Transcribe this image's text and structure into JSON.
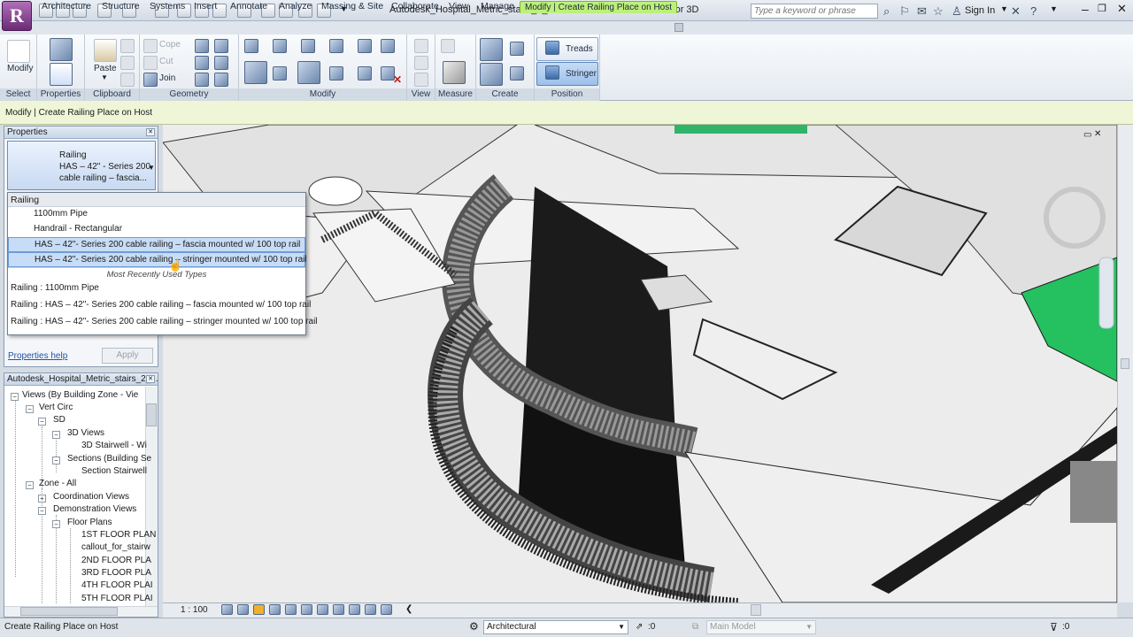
{
  "app": {
    "title": "Autodesk_Hospital_Metric_stairs_2_mccartl.rvt - 3D View: 2nd Floor 3D",
    "logo": "R",
    "search_placeholder": "Type a keyword or phrase",
    "sign_in": "Sign In"
  },
  "tabs": [
    "Architecture",
    "Structure",
    "Systems",
    "Insert",
    "Annotate",
    "Analyze",
    "Massing & Site",
    "Collaborate",
    "View",
    "Manage",
    "Modify | Create Railing Place on Host"
  ],
  "ribbon": {
    "modify": "Modify",
    "paste": "Paste",
    "cope": "Cope",
    "cut": "Cut",
    "join": "Join",
    "treads": "Treads",
    "stringer": "Stringer",
    "panels": [
      "Select",
      "Properties",
      "Clipboard",
      "Geometry",
      "Modify",
      "View",
      "Measure",
      "Create",
      "Position"
    ]
  },
  "options_bar": "Modify | Create Railing Place on Host",
  "properties": {
    "title": "Properties",
    "type_line1": "Railing",
    "type_line2": "HAS – 42\" - Series 200",
    "type_line3": "cable railing – fascia...",
    "help": "Properties help",
    "apply": "Apply"
  },
  "dropdown": {
    "header": "Railing",
    "items": [
      "1100mm Pipe",
      "Handrail - Rectangular",
      "HAS – 42\"- Series 200 cable railing – fascia mounted w/ 100 top rail",
      "HAS – 42\"- Series 200 cable railing – stringer mounted w/ 100 top rail"
    ],
    "mru_label": "Most Recently Used Types",
    "recent": [
      "Railing : 1100mm Pipe",
      "Railing : HAS – 42\"- Series 200 cable railing – fascia mounted w/ 100 top rail",
      "Railing : HAS – 42\"- Series 200 cable railing – stringer mounted w/ 100 top rail"
    ]
  },
  "browser": {
    "title": "Autodesk_Hospital_Metric_stairs_2_...",
    "items": [
      "Views (By Building Zone - Vie",
      "Vert Circ",
      "SD",
      "3D Views",
      "3D Stairwell - Wi",
      "Sections (Building Se",
      "Section Stairwell",
      "Zone - All",
      "Coordination Views",
      "Demonstration Views",
      "Floor Plans",
      "1ST FLOOR PLAN",
      "callout_for_stairw",
      "2ND FLOOR PLA",
      "3RD FLOOR PLA",
      "4TH FLOOR PLAI",
      "5TH FLOOR PLAI"
    ]
  },
  "view_controls": {
    "scale": "1 : 100"
  },
  "status": {
    "text": "Create Railing Place on Host",
    "workset": "Architectural",
    "count1": ":0",
    "model": "Main Model",
    "filter": ":0"
  }
}
